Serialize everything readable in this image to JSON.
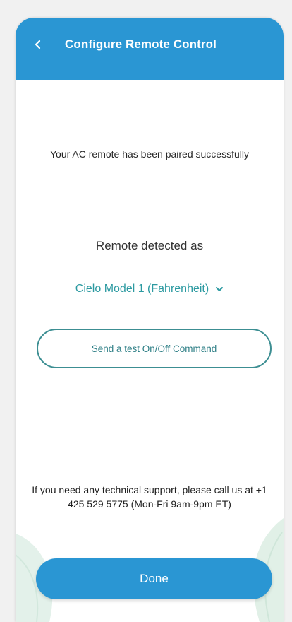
{
  "header": {
    "title": "Configure Remote Control",
    "back_icon": "chevron-left-icon",
    "background_color": "#2a96d3"
  },
  "main": {
    "paired_message": "Your AC remote has been paired successfully",
    "detected_label": "Remote detected as",
    "detected_model": {
      "selected_value": "Cielo Model 1 (Fahrenheit)",
      "icon": "chevron-down-icon",
      "color": "#2c9aa1"
    },
    "test_button_label": "Send a test On/Off Command",
    "support_text": "If you need any technical support, please call us at +1 425 529 5775 (Mon-Fri 9am-9pm ET)"
  },
  "footer": {
    "done_label": "Done",
    "done_color": "#2a96d3"
  }
}
